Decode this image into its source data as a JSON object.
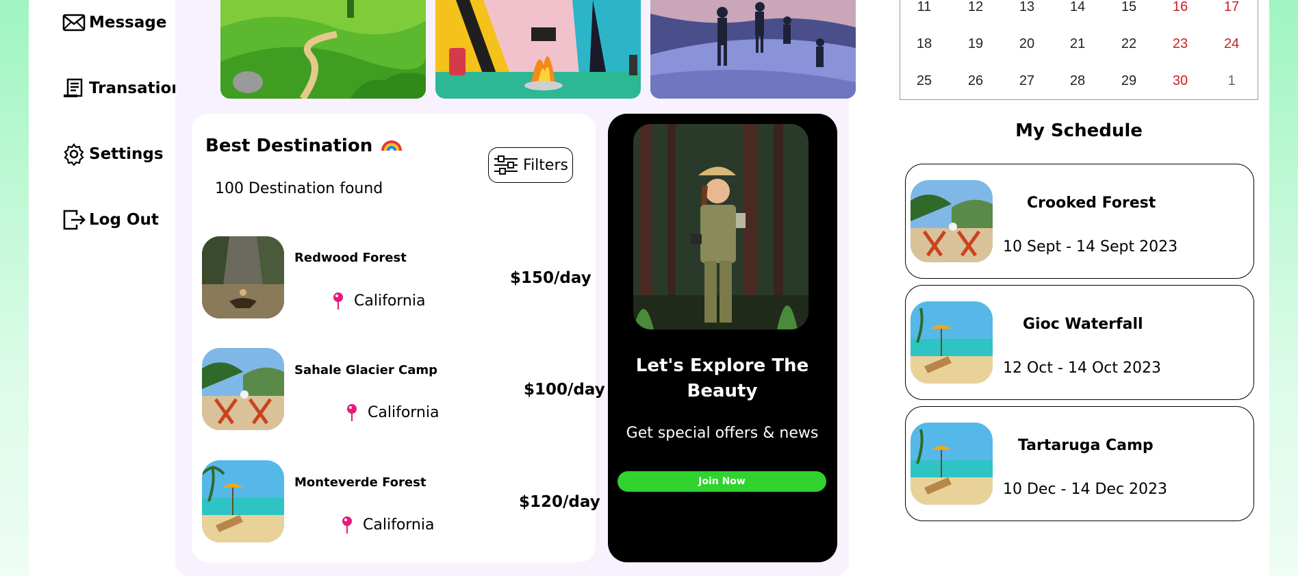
{
  "sidebar": {
    "items": [
      {
        "label": "Message",
        "icon": "envelope-icon"
      },
      {
        "label": "Transation",
        "icon": "receipt-icon"
      },
      {
        "label": "Settings",
        "icon": "gear-icon"
      },
      {
        "label": "Log Out",
        "icon": "logout-icon"
      }
    ]
  },
  "best_destination": {
    "title": "Best Destination",
    "emoji": "🌈",
    "count_text": "100 Destination found",
    "filters_label": "Filters",
    "items": [
      {
        "name": "Redwood Forest",
        "location": "California",
        "price": "$150/day"
      },
      {
        "name": "Sahale Glacier Camp",
        "location": "California",
        "price": "$100/day"
      },
      {
        "name": "Monteverde Forest",
        "location": "California",
        "price": "$120/day"
      }
    ]
  },
  "promo": {
    "title": "Let's Explore The Beauty",
    "subtitle": "Get special offers & news",
    "button_label": "Join Now"
  },
  "calendar": {
    "rows": [
      [
        "11",
        "12",
        "13",
        "14",
        "15",
        "16",
        "17"
      ],
      [
        "18",
        "19",
        "20",
        "21",
        "22",
        "23",
        "24"
      ],
      [
        "25",
        "26",
        "27",
        "28",
        "29",
        "30",
        "1"
      ]
    ]
  },
  "schedule": {
    "title": "My Schedule",
    "items": [
      {
        "name": "Crooked Forest",
        "dates": "10 Sept - 14 Sept 2023"
      },
      {
        "name": "Gioc Waterfall",
        "dates": "12 Oct - 14 Oct 2023"
      },
      {
        "name": "Tartaruga Camp",
        "dates": "10 Dec - 14 Dec 2023"
      }
    ]
  },
  "colors": {
    "accent_green": "#2fd22f",
    "weekend_red": "#cc1f1f",
    "pin_pink": "#e8197a",
    "panel_lavender": "#f7f2fd"
  }
}
